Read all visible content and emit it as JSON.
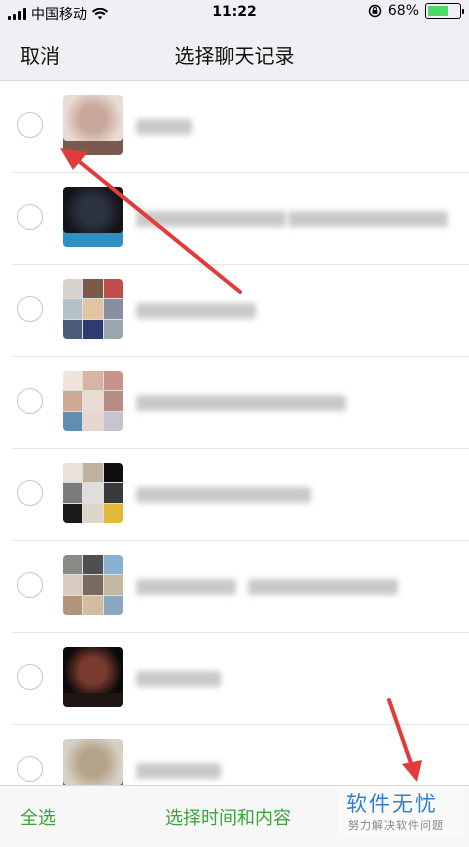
{
  "status_bar": {
    "carrier": "中国移动",
    "time": "11:22",
    "battery_percent": "68%",
    "battery_level": 0.68
  },
  "nav": {
    "cancel_label": "取消",
    "title": "选择聊天记录"
  },
  "chats": [
    {
      "avatar_type": "single",
      "avatar_colors": [
        "#e9dcd6",
        "#c9a89c",
        "#7a5a50"
      ]
    },
    {
      "avatar_type": "single",
      "avatar_colors": [
        "#141418",
        "#2b3240",
        "#2e8fc4"
      ]
    },
    {
      "avatar_type": "grid",
      "avatar_colors": [
        "#d8d2cc",
        "#7c5a4a",
        "#c04c4c",
        "#b5c1c8",
        "#e4c3a0",
        "#8a8fa0",
        "#4d5c7a",
        "#2e3b70",
        "#9aa6b0"
      ]
    },
    {
      "avatar_type": "grid",
      "avatar_colors": [
        "#efe5dd",
        "#d8b4a4",
        "#c8938c",
        "#cfa896",
        "#eadbd2",
        "#b58b84",
        "#5e8fb0",
        "#e7d6d2",
        "#c9c3cf"
      ]
    },
    {
      "avatar_type": "grid",
      "avatar_colors": [
        "#e8e2da",
        "#bfb09f",
        "#0f0f12",
        "#7c7c7c",
        "#e0dedc",
        "#3a3a3a",
        "#1a1a1a",
        "#dcd6c8",
        "#e1b83a"
      ]
    },
    {
      "avatar_type": "grid",
      "avatar_colors": [
        "#8a8a86",
        "#4f4f4f",
        "#8ab0cf",
        "#d9cbbf",
        "#7a6a60",
        "#c3b7a2",
        "#b3927e",
        "#d2bca2",
        "#8aa8c0"
      ]
    },
    {
      "avatar_type": "single",
      "avatar_colors": [
        "#0a0a0a",
        "#7a3a2e",
        "#1f1512"
      ]
    },
    {
      "avatar_type": "single",
      "avatar_colors": [
        "#d7d2c6",
        "#b5a28b",
        "#6e5a46"
      ]
    }
  ],
  "toolbar": {
    "select_all_label": "全选",
    "select_time_label": "选择时间和内容"
  },
  "watermark": {
    "main": "软件无忧",
    "sub": "努力解决软件问题"
  },
  "colors": {
    "accent_green": "#3aa53a",
    "arrow_red": "#e23b3b",
    "watermark_blue": "#2f7fd6"
  }
}
